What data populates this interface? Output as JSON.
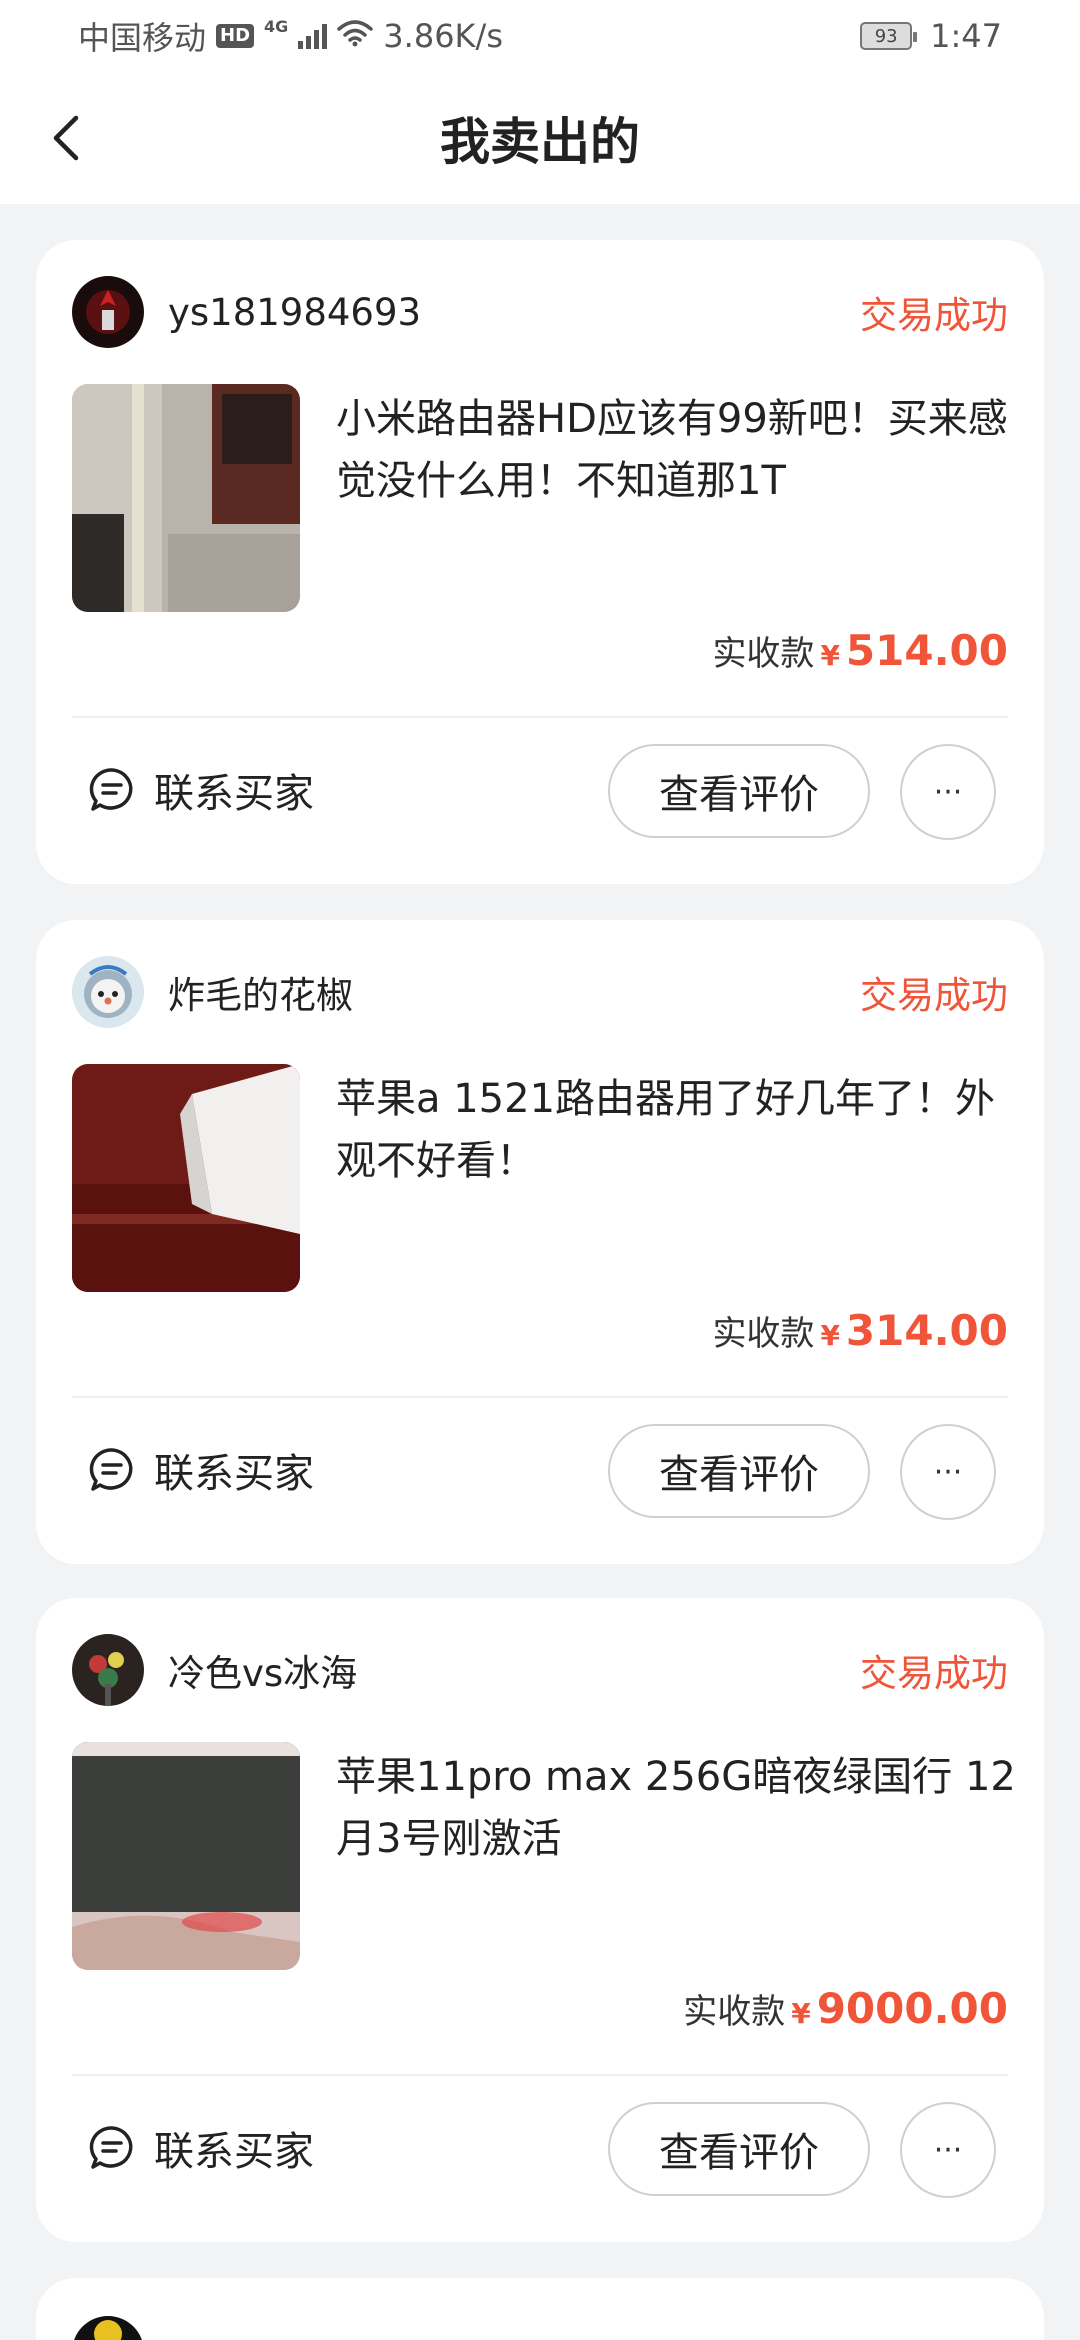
{
  "status_bar": {
    "carrier": "中国移动",
    "hd": "HD",
    "network": "4G",
    "speed": "3.86K/s",
    "battery": "93",
    "time": "1:47"
  },
  "header": {
    "title": "我卖出的"
  },
  "orders": [
    {
      "seller": "ys181984693",
      "status": "交易成功",
      "description": "小米路由器HD应该有99新吧！买来感觉没什么用！不知道那1T",
      "price_label": "实收款",
      "currency": "¥",
      "price": "514.00",
      "contact_label": "联系买家",
      "review_label": "查看评价",
      "more_label": "···"
    },
    {
      "seller": "炸毛的花椒",
      "status": "交易成功",
      "description": "苹果a 1521路由器用了好几年了！外观不好看！",
      "price_label": "实收款",
      "currency": "¥",
      "price": "314.00",
      "contact_label": "联系买家",
      "review_label": "查看评价",
      "more_label": "···"
    },
    {
      "seller": "冷色vs冰海",
      "status": "交易成功",
      "description": "苹果11pro max 256G暗夜绿国行 12月3号刚激活",
      "price_label": "实收款",
      "currency": "¥",
      "price": "9000.00",
      "contact_label": "联系买家",
      "review_label": "查看评价",
      "more_label": "···"
    }
  ],
  "colors": {
    "accent": "#f0553a",
    "background": "#f2f3f5",
    "card": "#ffffff"
  }
}
